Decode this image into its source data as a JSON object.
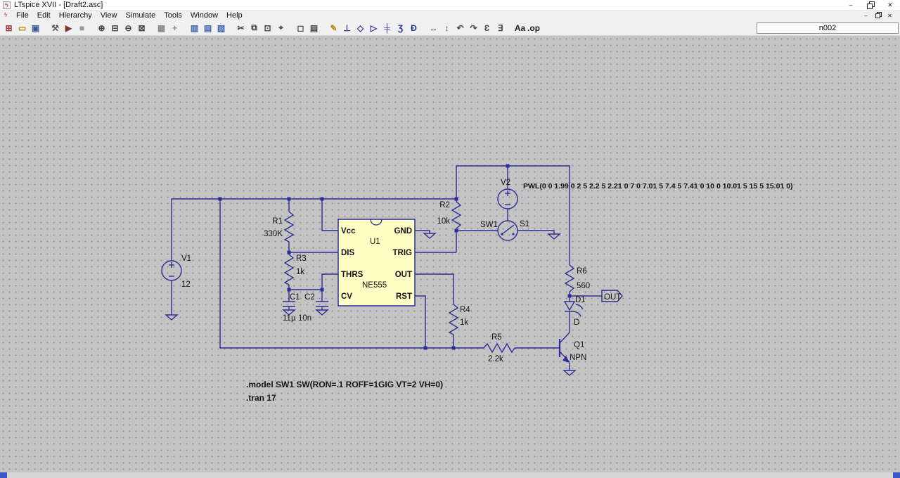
{
  "window": {
    "title": "LTspice XVII - [Draft2.asc]",
    "app_icon_glyph": "ϟ",
    "controls": {
      "minimize": "–",
      "close": "✕"
    },
    "mdi": {
      "minimize": "–",
      "close": "✕"
    }
  },
  "menu": {
    "items": [
      {
        "name": "menu-item-file",
        "label": "File"
      },
      {
        "name": "menu-item-edit",
        "label": "Edit"
      },
      {
        "name": "menu-item-hierarchy",
        "label": "Hierarchy"
      },
      {
        "name": "menu-item-view",
        "label": "View"
      },
      {
        "name": "menu-item-simulate",
        "label": "Simulate"
      },
      {
        "name": "menu-item-tools",
        "label": "Tools"
      },
      {
        "name": "menu-item-window",
        "label": "Window"
      },
      {
        "name": "menu-item-help",
        "label": "Help"
      }
    ]
  },
  "toolbar": {
    "net_box": "n002",
    "icons": [
      {
        "name": "new-schematic-icon",
        "glyph": "⊞",
        "tint": "#a23b3b"
      },
      {
        "name": "open-icon",
        "glyph": "▭",
        "tint": "#b8860b"
      },
      {
        "name": "save-icon",
        "glyph": "▣",
        "tint": "#3a5693"
      },
      {
        "name": "control-panel-icon",
        "glyph": "⚒",
        "tint": "#555555",
        "gap": true
      },
      {
        "name": "run-icon",
        "glyph": "▶",
        "tint": "#8a3030"
      },
      {
        "name": "halt-icon",
        "glyph": "■",
        "tint": "#999999"
      },
      {
        "name": "zoom-in-icon",
        "glyph": "⊕",
        "tint": "#444444",
        "gap": true
      },
      {
        "name": "zoom-back-icon",
        "glyph": "⊟",
        "tint": "#444444"
      },
      {
        "name": "zoom-out-icon",
        "glyph": "⊖",
        "tint": "#444444"
      },
      {
        "name": "zoom-full-icon",
        "glyph": "⊠",
        "tint": "#444444"
      },
      {
        "name": "grid-icon",
        "glyph": "▦",
        "tint": "#888888",
        "gap": true
      },
      {
        "name": "pan-icon",
        "glyph": "+",
        "tint": "#888888"
      },
      {
        "name": "tile-vertical-icon",
        "glyph": "▥",
        "tint": "#3b62b0",
        "gap": true
      },
      {
        "name": "tile-horizontal-icon",
        "glyph": "▤",
        "tint": "#3b62b0"
      },
      {
        "name": "cascade-icon",
        "glyph": "▧",
        "tint": "#3b62b0"
      },
      {
        "name": "cut-icon",
        "glyph": "✂",
        "tint": "#444444",
        "gap": true
      },
      {
        "name": "copy-icon",
        "glyph": "⧉",
        "tint": "#444444"
      },
      {
        "name": "paste-icon",
        "glyph": "⊡",
        "tint": "#444444"
      },
      {
        "name": "find-icon",
        "glyph": "⌖",
        "tint": "#444444"
      },
      {
        "name": "print-preview-icon",
        "glyph": "◻",
        "tint": "#444444",
        "gap": true
      },
      {
        "name": "print-icon",
        "glyph": "▤",
        "tint": "#444444"
      },
      {
        "name": "wire-icon",
        "glyph": "✎",
        "tint": "#b8860b",
        "gap": true
      },
      {
        "name": "ground-icon",
        "glyph": "⊥",
        "tint": "#2d2d96"
      },
      {
        "name": "label-icon",
        "glyph": "◇",
        "tint": "#2d2d96"
      },
      {
        "name": "diode-icon",
        "glyph": "▷",
        "tint": "#2d2d96"
      },
      {
        "name": "capacitor-icon",
        "glyph": "╪",
        "tint": "#2d2d96"
      },
      {
        "name": "inductor-icon",
        "glyph": "Ʒ",
        "tint": "#2d2d96"
      },
      {
        "name": "component-icon",
        "glyph": "Ð",
        "tint": "#2d2d96"
      },
      {
        "name": "move-icon",
        "glyph": "↔",
        "tint": "#444444",
        "gap": true
      },
      {
        "name": "drag-icon",
        "glyph": "↕",
        "tint": "#444444"
      },
      {
        "name": "undo-icon",
        "glyph": "↶",
        "tint": "#444444"
      },
      {
        "name": "redo-icon",
        "glyph": "↷",
        "tint": "#444444"
      },
      {
        "name": "rotate-icon",
        "glyph": "Ɛ",
        "tint": "#444444"
      },
      {
        "name": "mirror-icon",
        "glyph": "∃",
        "tint": "#444444"
      },
      {
        "name": "text-icon",
        "glyph": "Aa",
        "tint": "#222222",
        "gap": true
      },
      {
        "name": "spice-directive-icon",
        "glyph": ".op",
        "tint": "#222222"
      }
    ]
  },
  "schematic": {
    "colors": {
      "wire": "#2d2d96",
      "ic_fill": "#ffffc6",
      "text": "#141414"
    },
    "v1": {
      "ref": "V1",
      "value": "12"
    },
    "v2": {
      "ref": "V2",
      "value": "PWL(0 0 1.99 0 2 5 2.2 5 2.21 0 7 0 7.01 5 7.4 5 7.41 0 10 0 10.01 5 15 5 15.01 0)"
    },
    "r1": {
      "ref": "R1",
      "value": "330K"
    },
    "r2": {
      "ref": "R2",
      "value": "10k"
    },
    "r3": {
      "ref": "R3",
      "value": "1k"
    },
    "r4": {
      "ref": "R4",
      "value": "1k"
    },
    "r5": {
      "ref": "R5",
      "value": "2.2k"
    },
    "r6": {
      "ref": "R6",
      "value": "560"
    },
    "c1": {
      "ref": "C1",
      "value": "11µ"
    },
    "c2": {
      "ref": "C2",
      "value": "10n"
    },
    "u1": {
      "ref": "U1",
      "part": "NE555",
      "pins": {
        "vcc": "Vcc",
        "dis": "DIS",
        "thrs": "THRS",
        "cv": "CV",
        "gnd": "GND",
        "trig": "TRIG",
        "out": "OUT",
        "rst": "RST"
      }
    },
    "s1": {
      "ref": "S1",
      "model": "SW1"
    },
    "d1": {
      "ref": "D1",
      "value": "D"
    },
    "q1": {
      "ref": "Q1",
      "value": "NPN"
    },
    "out_port": {
      "label": "OUT"
    },
    "directives": {
      "model": ".model SW1 SW(RON=.1 ROFF=1GIG VT=2 VH=0)",
      "tran": ".tran 17"
    }
  }
}
